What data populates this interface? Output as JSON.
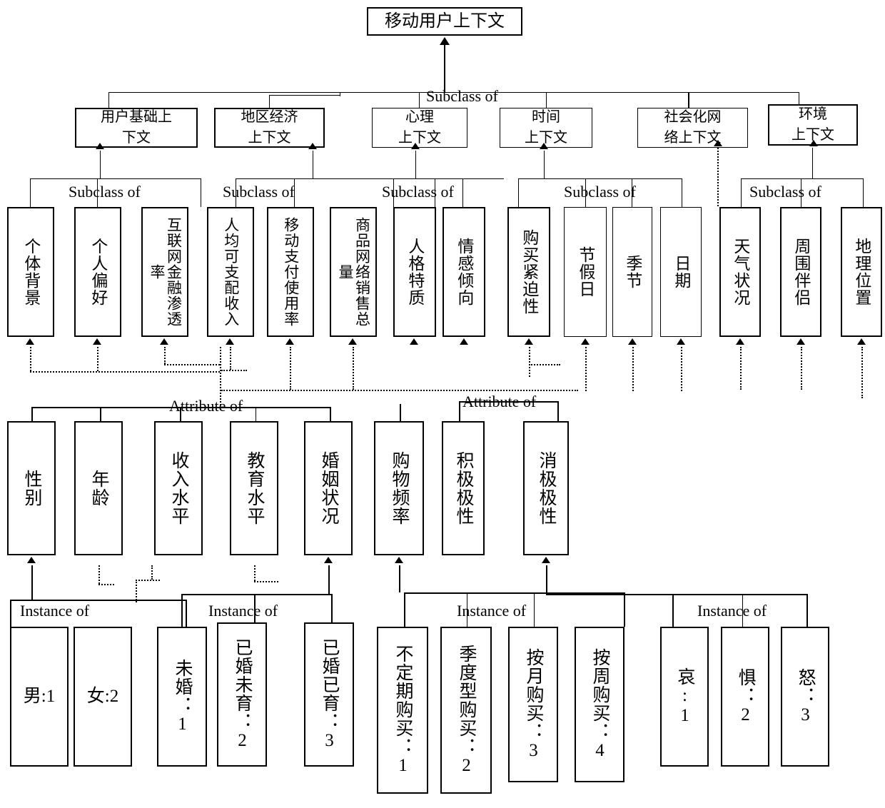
{
  "diagram": {
    "title": "移动用户上下文",
    "relations": {
      "subclass_of": "Subclass of",
      "attribute_of": "Attribute of",
      "instance_of": "Instance of"
    },
    "root": {
      "label": "移动用户上下文"
    },
    "level2": [
      {
        "id": "c1",
        "label": "用户基础上\n下文",
        "line1": "用户基础上",
        "line2": "下文"
      },
      {
        "id": "c2",
        "label": "地区经济\n上下文",
        "line1": "地区经济",
        "line2": "上下文"
      },
      {
        "id": "c3",
        "label": "心理\n上下文",
        "line1": "心理",
        "line2": "上下文"
      },
      {
        "id": "c4",
        "label": "时间\n上下文",
        "line1": "时间",
        "line2": "上下文"
      },
      {
        "id": "c5",
        "label": "社会化网\n络上下文",
        "line1": "社会化网",
        "line2": "络上下文"
      },
      {
        "id": "c6",
        "label": "环境\n上下文",
        "line1": "环境",
        "line2": "上下文"
      }
    ],
    "level3": [
      {
        "id": "a1",
        "label": "个体背景",
        "parent": "c1",
        "cols": 1
      },
      {
        "id": "a2",
        "label": "个人偏好",
        "parent": "c1",
        "cols": 1
      },
      {
        "id": "a3",
        "label": "互联网金融渗透率",
        "parent": "c2",
        "cols": 2,
        "col1": "互联网融透",
        "col2": "联金渗率"
      },
      {
        "id": "a4",
        "label": "人均可支配收入",
        "parent": "c2",
        "cols": 2,
        "col1": "人可配入",
        "col2": "均支收"
      },
      {
        "id": "a5",
        "label": "移动支付使用率",
        "parent": "c2",
        "cols": 2,
        "col1": "移支使率",
        "col2": "动付用"
      },
      {
        "id": "a6",
        "label": "商品网络销售总量",
        "parent": "c2",
        "cols": 2,
        "col1": "商网销总",
        "col2": "品络售量"
      },
      {
        "id": "a7",
        "label": "人格特质",
        "parent": "c3",
        "cols": 1
      },
      {
        "id": "a8",
        "label": "情感倾向",
        "parent": "c3",
        "cols": 1
      },
      {
        "id": "a9",
        "label": "购买紧迫性",
        "parent": "c4",
        "cols": 1
      },
      {
        "id": "a10",
        "label": "节假日",
        "parent": "c4",
        "cols": 1
      },
      {
        "id": "a11",
        "label": "季节",
        "parent": "c4",
        "cols": 1
      },
      {
        "id": "a12",
        "label": "日期",
        "parent": "c4",
        "cols": 1
      },
      {
        "id": "a13",
        "label": "天气状况",
        "parent": "c6",
        "cols": 1
      },
      {
        "id": "a14",
        "label": "周围伴侣",
        "parent": "c5",
        "cols": 1
      },
      {
        "id": "a15",
        "label": "地理位置",
        "parent": "c6",
        "cols": 1
      }
    ],
    "level4": [
      {
        "id": "b1",
        "label": "性别",
        "attribute_of": "a1"
      },
      {
        "id": "b2",
        "label": "年龄",
        "attribute_of": "a1"
      },
      {
        "id": "b3",
        "label": "收入水平",
        "attribute_of": "a1"
      },
      {
        "id": "b4",
        "label": "教育水平",
        "attribute_of": "a1"
      },
      {
        "id": "b5",
        "label": "婚姻状况",
        "attribute_of": "a1"
      },
      {
        "id": "b6",
        "label": "购物频率",
        "attribute_of": "a2"
      },
      {
        "id": "b7",
        "label": "积极极性",
        "attribute_of": "a8"
      },
      {
        "id": "b8",
        "label": "消极极性",
        "attribute_of": "a8"
      }
    ],
    "instances": [
      {
        "id": "i1",
        "label": "男:1",
        "orient": "horiz",
        "instance_of": "b1"
      },
      {
        "id": "i2",
        "label": "女:2",
        "orient": "horiz",
        "instance_of": "b1"
      },
      {
        "id": "i3",
        "label": "未婚：1",
        "orient": "vert",
        "instance_of": "b5"
      },
      {
        "id": "i4",
        "label": "已婚未育：2",
        "orient": "vert",
        "instance_of": "b5"
      },
      {
        "id": "i5",
        "label": "已婚已育：3",
        "orient": "vert",
        "instance_of": "b5"
      },
      {
        "id": "i6",
        "label": "不定期购买：1",
        "orient": "vert",
        "instance_of": "b6"
      },
      {
        "id": "i7",
        "label": "季度型购买：2",
        "orient": "vert",
        "instance_of": "b6"
      },
      {
        "id": "i8",
        "label": "按月购买：3",
        "orient": "vert",
        "instance_of": "b6"
      },
      {
        "id": "i9",
        "label": "按周购买：4",
        "orient": "vert",
        "instance_of": "b6"
      },
      {
        "id": "i10",
        "label": "哀:1",
        "orient": "vert",
        "instance_of": "b8"
      },
      {
        "id": "i11",
        "label": "惧：2",
        "orient": "vert",
        "instance_of": "b8"
      },
      {
        "id": "i12",
        "label": "怒：3",
        "orient": "vert",
        "instance_of": "b8"
      }
    ],
    "relation_labels": [
      {
        "id": "sub1",
        "text": "Subclass of"
      },
      {
        "id": "sub2",
        "text": "Subclass of"
      },
      {
        "id": "sub3",
        "text": "Subclass of"
      },
      {
        "id": "sub4",
        "text": "Subclass of"
      },
      {
        "id": "sub5",
        "text": "Subclass of"
      },
      {
        "id": "sub6",
        "text": "Subclass of"
      },
      {
        "id": "attr1",
        "text": "Attribute of"
      },
      {
        "id": "attr2",
        "text": "Attribute of"
      },
      {
        "id": "inst1",
        "text": "Instance of"
      },
      {
        "id": "inst2",
        "text": "Instance of"
      },
      {
        "id": "inst3",
        "text": "Instance of"
      },
      {
        "id": "inst4",
        "text": "Instance of"
      }
    ],
    "colors": {
      "line": "#000000",
      "box_border": "#000000",
      "background": "#ffffff",
      "text": "#000000"
    }
  }
}
